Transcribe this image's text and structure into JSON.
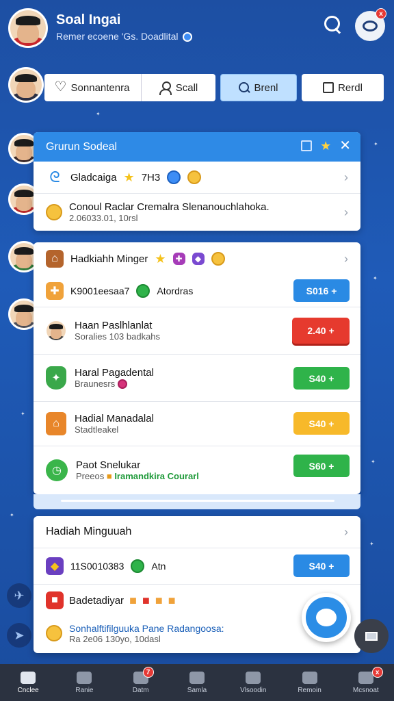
{
  "header": {
    "title": "Soal Ingai",
    "subtitle": "Remer ecoene 'Gs. Doadlital",
    "profile_badge": "x"
  },
  "tabs": [
    {
      "label": "Sonnantenra",
      "icon": "heart-icon"
    },
    {
      "label": "Scall",
      "icon": "user-icon"
    },
    {
      "label": "Brenl",
      "icon": "search-icon",
      "active": true
    },
    {
      "label": "Rerdl",
      "icon": "note-icon"
    }
  ],
  "group_card": {
    "title": "Grurun Sodeal",
    "rows": [
      {
        "title": "Gladcaiga",
        "extra": "7Н3"
      },
      {
        "title": "Conoul Raclar Cremalra Slenanouchlahoka.",
        "sub": "2.06033.01, 10rsl"
      }
    ]
  },
  "reward_card": {
    "title": "Hadkiahh Minger",
    "rows": [
      {
        "title": "K9001eesaa7",
        "sub": "Atordras",
        "button": "S016 +",
        "color": "blue"
      },
      {
        "title": "Haan Paslhlanlat",
        "sub": "Soralies 103 badkahs",
        "button": "2.40 +",
        "color": "red"
      },
      {
        "title": "Haral Pagadental",
        "sub": "Braunesrs",
        "button": "S40 +",
        "color": "green"
      },
      {
        "title": "Hadial Manadalal",
        "sub": "Stadtleakel",
        "button": "S40 +",
        "color": "yellow"
      },
      {
        "title": "Paot Snelukar",
        "sub": "Preeos",
        "sub2": "Iramandkira Courarl",
        "button": "S60 +",
        "color": "green"
      }
    ]
  },
  "weekly_card": {
    "title": "Hadiah Minguuah",
    "rows": [
      {
        "title": "11S0010383",
        "sub": "Atn",
        "button": "S40 +",
        "color": "blue"
      },
      {
        "title": "Badetadiyar"
      },
      {
        "title": "Sonhalftifilguuka Pane Radangoosa:",
        "sub": "Ra 2e06 130yo, 10dasl"
      }
    ]
  },
  "bottom_nav": [
    {
      "label": "Cnclee",
      "active": true
    },
    {
      "label": "Ranie"
    },
    {
      "label": "Datm",
      "badge": "7"
    },
    {
      "label": "Samla"
    },
    {
      "label": "Vlsoodin"
    },
    {
      "label": "Remoin"
    },
    {
      "label": "Mcsnoat",
      "badge": "x"
    }
  ],
  "colors": {
    "accent": "#2e8ae6",
    "background": "#1f5bb8",
    "nav": "#2b3240"
  }
}
